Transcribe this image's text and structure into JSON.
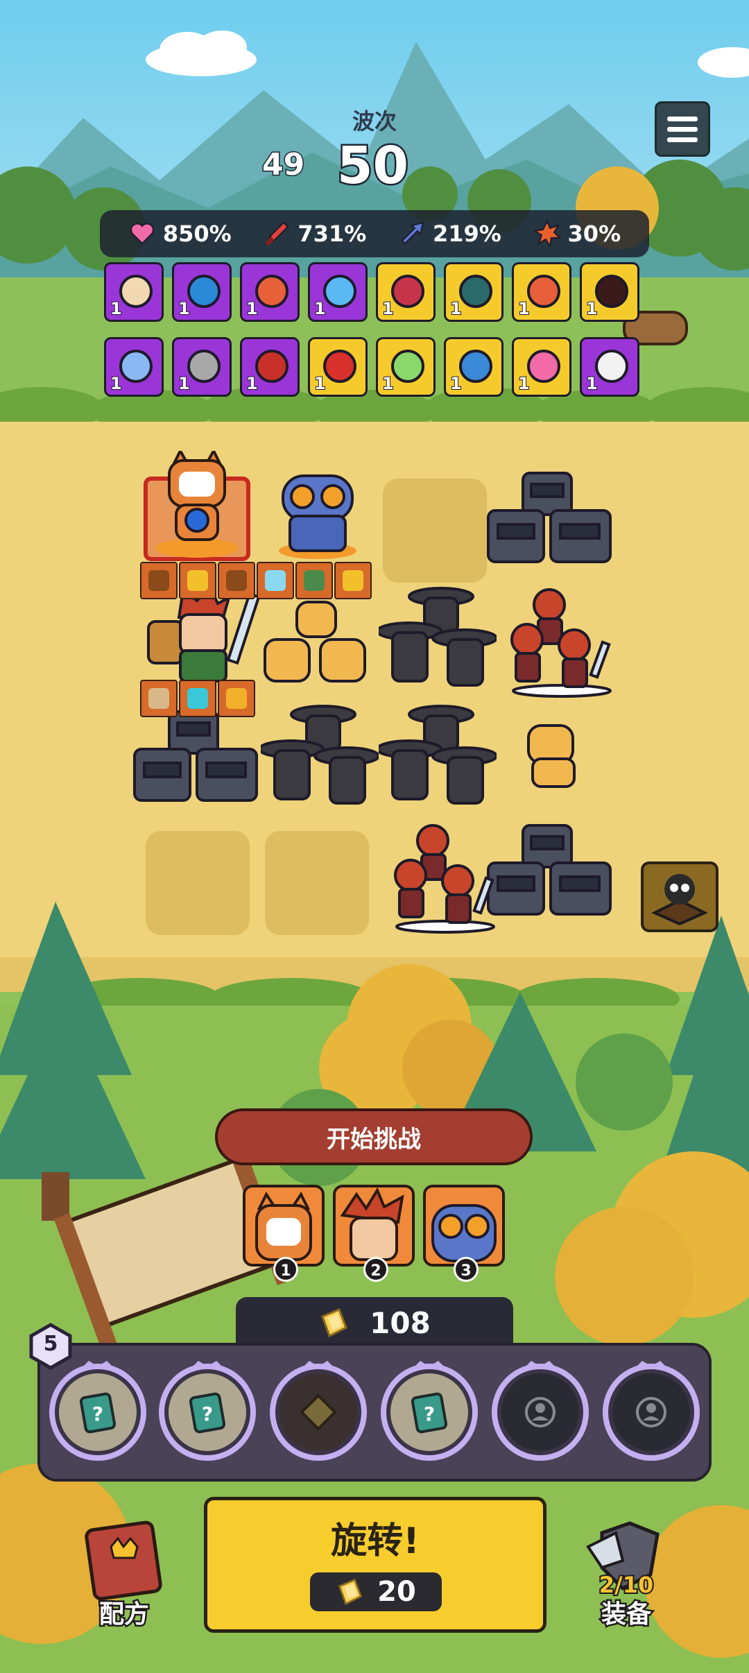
{
  "hud": {
    "wave_label": "波次",
    "prev_wave": "49",
    "current_wave": "50",
    "menu_icon": "hamburger-menu-icon"
  },
  "stats": [
    {
      "icon": "heart-icon",
      "value": "850%",
      "color": "#f26aa8"
    },
    {
      "icon": "sword-icon",
      "value": "731%",
      "color": "#e2403a"
    },
    {
      "icon": "speed-arrow-icon",
      "value": "219%",
      "color": "#5a7ad8"
    },
    {
      "icon": "crit-burst-icon",
      "value": "30%",
      "color": "#e8602c"
    }
  ],
  "buffs": {
    "row1": [
      {
        "icon": "house-icon",
        "count": "1",
        "tier": "purple"
      },
      {
        "icon": "magic-wand-icon",
        "count": "1",
        "tier": "purple"
      },
      {
        "icon": "fire-orb-icon",
        "count": "1",
        "tier": "purple"
      },
      {
        "icon": "blue-vortex-icon",
        "count": "1",
        "tier": "purple"
      },
      {
        "icon": "heart-rate-icon",
        "count": "1",
        "tier": "yellow"
      },
      {
        "icon": "treasure-chest-icon",
        "count": "1",
        "tier": "yellow"
      },
      {
        "icon": "hammer-fire-icon",
        "count": "1",
        "tier": "yellow"
      },
      {
        "icon": "bomb-icon",
        "count": "1",
        "tier": "yellow"
      }
    ],
    "row2": [
      {
        "icon": "lightning-swirl-icon",
        "count": "1",
        "tier": "purple"
      },
      {
        "icon": "gravestone-icon",
        "count": "1",
        "tier": "purple"
      },
      {
        "icon": "blood-splash-icon",
        "count": "1",
        "tier": "purple"
      },
      {
        "icon": "blood-drop-icon",
        "count": "1",
        "tier": "yellow"
      },
      {
        "icon": "green-wind-icon",
        "count": "1",
        "tier": "yellow"
      },
      {
        "icon": "stopwatch-icon",
        "count": "1",
        "tier": "yellow"
      },
      {
        "icon": "heart-flower-icon",
        "count": "1",
        "tier": "yellow"
      },
      {
        "icon": "crowd-icon",
        "count": "1",
        "tier": "purple"
      }
    ]
  },
  "board": {
    "skull_icon": "skull-portal-icon",
    "equipment_row1": [
      "crossbow-icon",
      "flame-sword-icon",
      "crossbow-icon",
      "ice-heart-icon",
      "herb-bowl-icon",
      "horn-icon"
    ],
    "equipment_row2": [
      "drum-icon",
      "crystal-heart-icon",
      "golden-helmet-icon"
    ]
  },
  "challenge": {
    "label": "开始挑战",
    "heroes": [
      {
        "name": "cat-hero",
        "number": "1"
      },
      {
        "name": "red-hair-hero",
        "number": "2"
      },
      {
        "name": "robot-hero",
        "number": "3"
      }
    ]
  },
  "bottom": {
    "coins": "108",
    "level": "5",
    "slots": [
      "card-slot",
      "card-slot",
      "rune-slot",
      "card-slot",
      "locked-slot",
      "locked-slot"
    ],
    "spin_label": "旋转!",
    "spin_cost": "20",
    "recipes_label": "配方",
    "equip_label": "装备",
    "equip_count": "2/10"
  },
  "colors": {
    "sky": "#7dd3ee",
    "field": "#eed37a",
    "grass": "#8fc35a",
    "purple_tier": "#9a36d8",
    "yellow_tier": "#f5cb2c"
  }
}
